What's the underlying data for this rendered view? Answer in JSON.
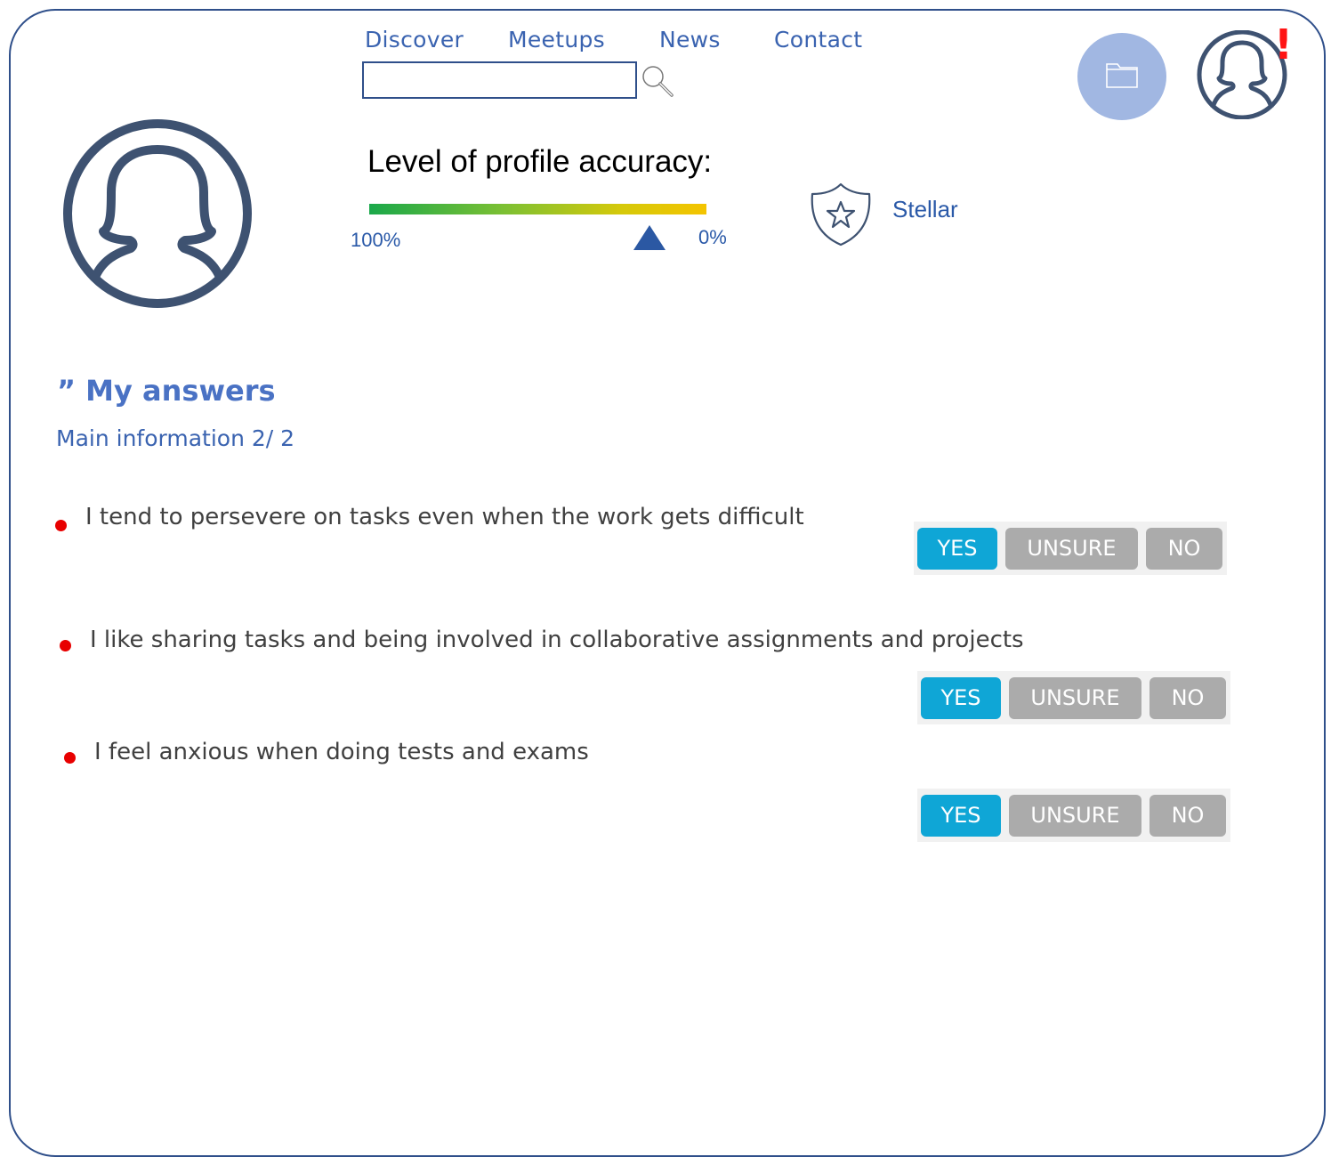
{
  "nav": {
    "links": [
      "Discover",
      "Meetups",
      "News",
      "Contact"
    ]
  },
  "search": {
    "value": "",
    "placeholder": ""
  },
  "accuracy": {
    "title": "Level of profile accuracy:",
    "left_label": "100%",
    "right_label": "0%",
    "level_percent": 17
  },
  "badge": {
    "label": "Stellar"
  },
  "alert": {
    "mark": "!"
  },
  "answers": {
    "title": "” My answers",
    "subtitle": "Main information 2/ 2",
    "questions": [
      {
        "text": "I tend to persevere on tasks even when the work gets difficult",
        "yes": "YES",
        "unsure": "UNSURE",
        "no": "NO",
        "selected": "YES"
      },
      {
        "text": "I like sharing tasks and being involved in collaborative assignments and projects",
        "yes": "YES",
        "unsure": "UNSURE",
        "no": "NO",
        "selected": "YES"
      },
      {
        "text": "I feel anxious when doing tests and exams",
        "yes": "YES",
        "unsure": "UNSURE",
        "no": "NO",
        "selected": "YES"
      }
    ]
  },
  "colors": {
    "frame": "#2f4f8a",
    "link": "#3a63b0",
    "yes_active": "#0fa6d6",
    "inactive": "#ababab",
    "bullet": "#e80000",
    "alert": "#ff1414",
    "folder_bg": "#a1b7e2"
  },
  "icons": [
    "search-icon",
    "folder-icon",
    "user-avatar-icon",
    "star-shield-icon"
  ]
}
